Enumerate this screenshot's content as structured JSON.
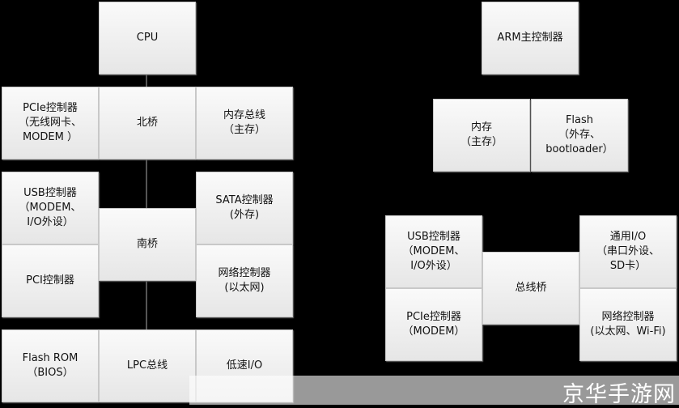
{
  "left": {
    "cpu": "CPU",
    "pcie": "PCIe控制器\n（无线网卡、\nMODEM ）",
    "northbridge": "北桥",
    "memory_bus": "内存总线\n（主存）",
    "usb": "USB控制器\n（MODEM、\nI/O外设）",
    "pci": "PCI控制器",
    "southbridge": "南桥",
    "sata": "SATA控制器\n(外存)",
    "network": "网络控制器\n(以太网)",
    "flash_rom": "Flash ROM\n（BIOS）",
    "lpc": "LPC总线",
    "low_speed_io": "低速I/O"
  },
  "right": {
    "arm": "ARM主控制器",
    "memory": "内存\n（主存）",
    "flash": "Flash\n（外存、\nbootloader）",
    "usb": "USB控制器\n（MODEM、\nI/O外设）",
    "pcie": "PCIe控制器\n（MODEM）",
    "bus_bridge": "总线桥",
    "gpio": "通用I/O\n（串口外设、\nSD卡）",
    "network": "网络控制器\n(以太网、Wi-Fi)"
  },
  "watermark": "京华手游网"
}
